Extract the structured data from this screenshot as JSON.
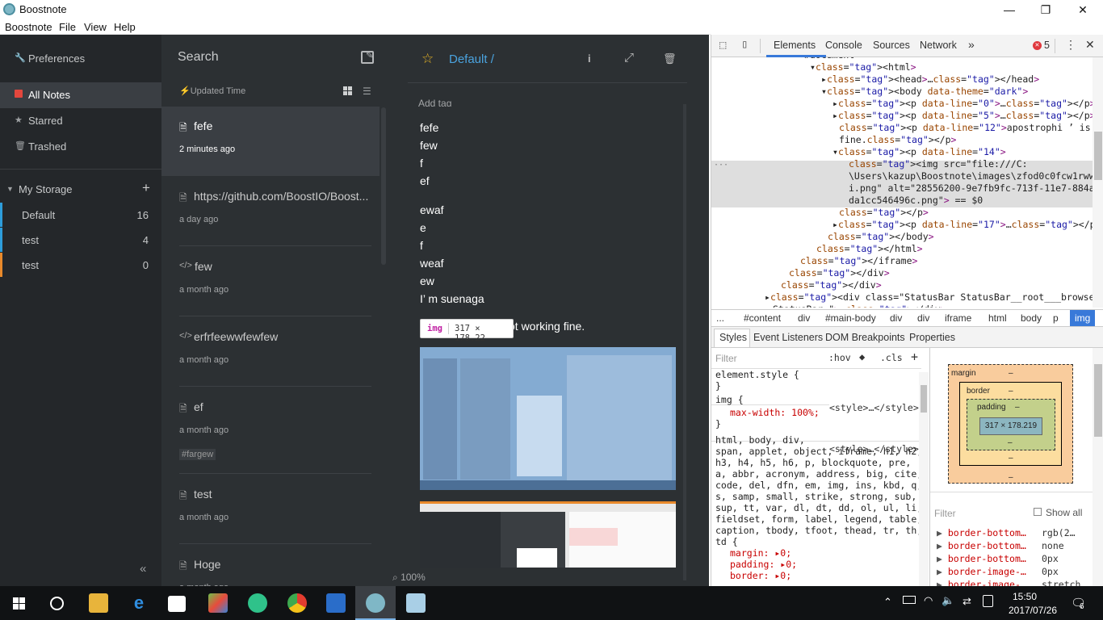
{
  "window": {
    "title": "Boostnote",
    "minimize": "—",
    "restore": "❐",
    "close": "✕"
  },
  "menu": [
    "Boostnote",
    "File",
    "View",
    "Help"
  ],
  "sidebar": {
    "preferences": "Preferences",
    "items": [
      {
        "label": "All Notes",
        "icon": "note-icon"
      },
      {
        "label": "Starred",
        "icon": "star-icon"
      },
      {
        "label": "Trashed",
        "icon": "trash-icon"
      }
    ],
    "storage_title": "My Storage",
    "storage_add": "+",
    "folders": [
      {
        "label": "Default",
        "count": "16",
        "color": "#2d9ddb"
      },
      {
        "label": "test",
        "count": "4",
        "color": "#2d9ddb"
      },
      {
        "label": "test",
        "count": "0",
        "color": "#e8892b"
      }
    ],
    "collapse": "«"
  },
  "notelist": {
    "search_placeholder": "Search",
    "sort_label": "Updated Time",
    "notes": [
      {
        "title": "fefe",
        "date": "2 minutes ago",
        "tag": "",
        "icon": "doc-icon"
      },
      {
        "title": "https://github.com/BoostIO/Boost...",
        "date": "a day ago",
        "tag": "",
        "icon": "doc-icon"
      },
      {
        "title": "few",
        "date": "a month ago",
        "tag": "",
        "icon": "code-icon"
      },
      {
        "title": "erfrfeewwfewfew",
        "date": "a month ago",
        "tag": "",
        "icon": "code-icon"
      },
      {
        "title": "ef",
        "date": "a month ago",
        "tag": "#fargew",
        "icon": "doc-icon"
      },
      {
        "title": "test",
        "date": "a month ago",
        "tag": "",
        "icon": "doc-icon"
      },
      {
        "title": "Hoge",
        "date": "a month ago",
        "tag": "",
        "icon": "doc-icon"
      }
    ]
  },
  "detail": {
    "folder": "Default /",
    "add_tag": "Add tag",
    "lines1": [
      "fefe",
      "few",
      "f",
      "ef"
    ],
    "lines2": [
      "ewaf",
      "e",
      "f",
      "weaf",
      "ew",
      "I’  m suenaga"
    ],
    "partial_line": "ot working fine.",
    "tooltip_tag": "img",
    "tooltip_size": "317 × 178.22",
    "zoom": "100%"
  },
  "devtools": {
    "tabs": [
      "Elements",
      "Console",
      "Sources",
      "Network"
    ],
    "error_count": "5",
    "dom_lines": [
      {
        "indent": 108,
        "text": "▾#document"
      },
      {
        "indent": 122,
        "text": "▾<html>"
      },
      {
        "indent": 136,
        "text": "▸<head>…</head>"
      },
      {
        "indent": 136,
        "text": "▾<body data-theme=\"dark\">"
      },
      {
        "indent": 150,
        "text": "▸<p data-line=\"0\">…</p>"
      },
      {
        "indent": 150,
        "text": "▸<p data-line=\"5\">…</p>"
      },
      {
        "indent": 158,
        "text": "<p data-line=\"12\">apostrophi ’ is not working"
      },
      {
        "indent": 158,
        "text": "fine.</p>"
      },
      {
        "indent": 150,
        "text": "▾<p data-line=\"14\">"
      },
      {
        "indent": 170,
        "text": "<img src=\"file:///C:"
      },
      {
        "indent": 170,
        "text": "\\Users\\kazup\\Boostnote\\images\\zfod0c0fcw1rwwm"
      },
      {
        "indent": 170,
        "text": "i.png\" alt=\"28556200-9e7fb9fc-713f-11e7-884a-"
      },
      {
        "indent": 170,
        "text": "da1cc546496c.png\"> == $0"
      },
      {
        "indent": 158,
        "text": "</p>"
      },
      {
        "indent": 150,
        "text": "▸<p data-line=\"17\">…</p>"
      },
      {
        "indent": 144,
        "text": "</body>"
      },
      {
        "indent": 130,
        "text": "</html>"
      },
      {
        "indent": 110,
        "text": "</iframe>"
      },
      {
        "indent": 96,
        "text": "</div>"
      },
      {
        "indent": 86,
        "text": "</div>"
      },
      {
        "indent": 66,
        "text": "▸<div class=\"StatusBar StatusBar__root___browser-main-"
      },
      {
        "indent": 76,
        "text": "StatusBar-\">…</div>"
      }
    ],
    "breadcrumbs": [
      "...",
      "#content",
      "div",
      "#main-body",
      "div",
      "div",
      "iframe",
      "html",
      "body",
      "p",
      "img"
    ],
    "subtabs": [
      "Styles",
      "Event Listeners",
      "DOM Breakpoints",
      "Properties"
    ],
    "filter_placeholder": "Filter",
    "hov": ":hov",
    "cls": ".cls",
    "styles": [
      "element.style {",
      "}",
      "img {",
      "  max-width: 100%;",
      "}",
      "html, body, div,",
      "span, applet, object, iframe, h1, h2,",
      "h3, h4, h5, h6, p, blockquote, pre,",
      "a, abbr, acronym, address, big, cite,",
      "code, del, dfn, em, img, ins, kbd, q,",
      "s, samp, small, strike, strong, sub,",
      "sup, tt, var, dl, dt, dd, ol, ul, li,",
      "fieldset, form, label, legend, table,",
      "caption, tbody, tfoot, thead, tr, th,",
      "td {",
      "  margin: ▸0;",
      "  padding: ▸0;",
      "  border: ▸0;"
    ],
    "style_src1": "<style>…</style>",
    "style_src2": "<style>…</style>",
    "box": {
      "margin": "margin",
      "border": "border",
      "padding": "padding",
      "dash": "–",
      "content": "317 × 178.219"
    },
    "computed_filter": "Filter",
    "show_all": "Show all",
    "computed": [
      {
        "prop": "border-bottom…",
        "val": "rgb(2…"
      },
      {
        "prop": "border-bottom…",
        "val": "none"
      },
      {
        "prop": "border-bottom…",
        "val": "0px"
      },
      {
        "prop": "border-image-…",
        "val": "0px"
      },
      {
        "prop": "border-image-…",
        "val": "stretch"
      }
    ]
  },
  "taskbar": {
    "time": "15:50",
    "date": "2017/07/26",
    "notif": "6"
  }
}
